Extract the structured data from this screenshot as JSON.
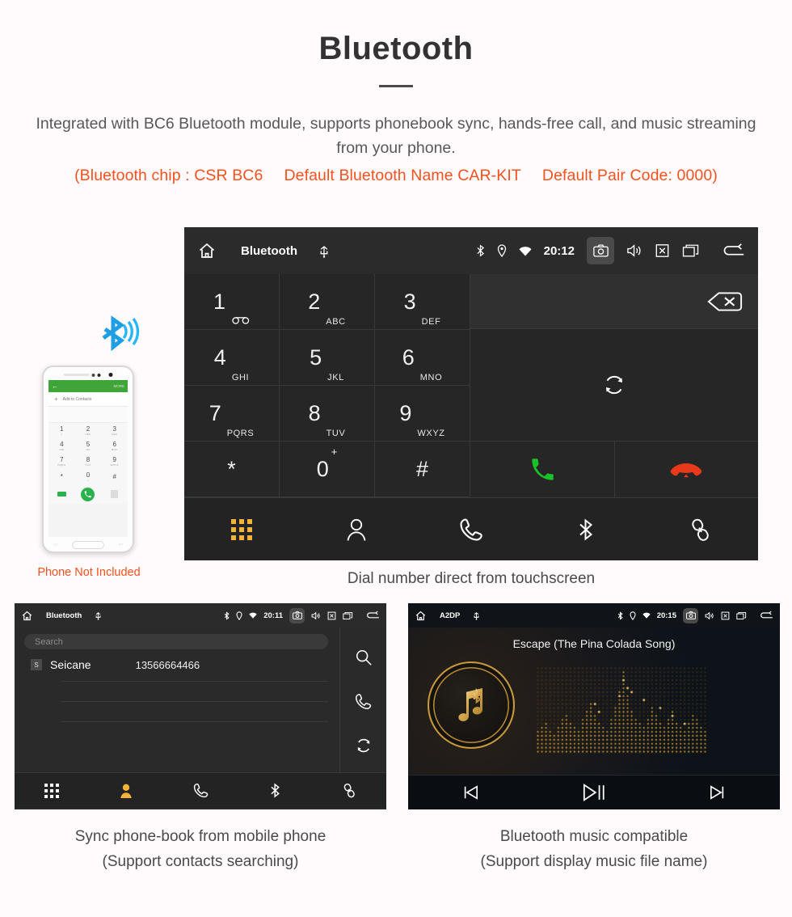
{
  "header": {
    "title": "Bluetooth",
    "description": "Integrated with BC6 Bluetooth module, supports phonebook sync, hands-free call, and music streaming from your phone.",
    "spec_open": "(Bluetooth chip : CSR BC6",
    "spec_name": "Default Bluetooth Name CAR-KIT",
    "spec_pair": "Default Pair Code: 0000)",
    "accent_color": "#f4511e",
    "title_color": "#333333"
  },
  "dialer": {
    "statusbar": {
      "home_icon": "home-icon",
      "title": "Bluetooth",
      "usb_icon": "usb-icon",
      "bluetooth_icon": "bluetooth-icon",
      "location_icon": "location-icon",
      "wifi_icon": "wifi-icon",
      "time": "20:12",
      "camera_icon": "camera-icon",
      "volume_icon": "volume-icon",
      "mute_icon": "mute-box-icon",
      "recents_icon": "recents-icon",
      "back_icon": "back-icon"
    },
    "keys": [
      {
        "num": "1",
        "sub": "",
        "voicemail": true
      },
      {
        "num": "2",
        "sub": "ABC"
      },
      {
        "num": "3",
        "sub": "DEF"
      },
      {
        "num": "4",
        "sub": "GHI"
      },
      {
        "num": "5",
        "sub": "JKL"
      },
      {
        "num": "6",
        "sub": "MNO"
      },
      {
        "num": "7",
        "sub": "PQRS"
      },
      {
        "num": "8",
        "sub": "TUV"
      },
      {
        "num": "9",
        "sub": "WXYZ"
      },
      {
        "num": "*",
        "sub": ""
      },
      {
        "num": "0",
        "sup": "+"
      },
      {
        "num": "#",
        "sub": ""
      }
    ],
    "number_display": "",
    "backspace_icon": "backspace-icon",
    "sync_icon": "sync-icon",
    "call_icon": "call-icon",
    "hangup_icon": "hangup-icon",
    "call_color": "#18c227",
    "hangup_color": "#e8391a",
    "tabs": [
      {
        "name": "dialpad",
        "icon": "dialpad-icon",
        "active": true
      },
      {
        "name": "contacts",
        "icon": "person-icon",
        "active": false
      },
      {
        "name": "call-log",
        "icon": "handset-icon",
        "active": false
      },
      {
        "name": "bluetooth",
        "icon": "bluetooth-icon",
        "active": false
      },
      {
        "name": "pair",
        "icon": "link-icon",
        "active": false
      }
    ],
    "active_tab_color": "#f3b23c",
    "caption": "Dial number direct from touchscreen"
  },
  "phone_mockup": {
    "app_back_icon": "arrow-back-icon",
    "app_more_label": "MORE",
    "add_contacts_label": "Add to Contacts",
    "keys": [
      {
        "num": "1",
        "sub": "∞"
      },
      {
        "num": "2",
        "sub": "ABC"
      },
      {
        "num": "3",
        "sub": "DEF"
      },
      {
        "num": "4",
        "sub": "GHI"
      },
      {
        "num": "5",
        "sub": "JKL"
      },
      {
        "num": "6",
        "sub": "MNO"
      },
      {
        "num": "7",
        "sub": "PQRS"
      },
      {
        "num": "8",
        "sub": "TUV"
      },
      {
        "num": "9",
        "sub": "WXYZ"
      },
      {
        "num": "*",
        "sub": ""
      },
      {
        "num": "0",
        "sub": "+"
      },
      {
        "num": "#",
        "sub": ""
      }
    ],
    "not_included_label": "Phone Not Included",
    "bluetooth_signal_icon": "bluetooth-signal-icon",
    "signal_color": "#1e9fe3"
  },
  "contacts": {
    "statusbar": {
      "home_icon": "home-icon",
      "title": "Bluetooth",
      "usb_icon": "usb-icon",
      "time": "20:11"
    },
    "search_placeholder": "Search",
    "rows": [
      {
        "badge": "S",
        "name": "Seicane",
        "number": "13566664466"
      }
    ],
    "side_actions": [
      {
        "name": "search",
        "icon": "search-icon"
      },
      {
        "name": "call",
        "icon": "handset-icon"
      },
      {
        "name": "sync",
        "icon": "sync-icon"
      }
    ],
    "tabs": [
      {
        "name": "dialpad",
        "icon": "dialpad-icon",
        "active": false
      },
      {
        "name": "contacts",
        "icon": "person-icon",
        "active": true
      },
      {
        "name": "call-log",
        "icon": "handset-icon",
        "active": false
      },
      {
        "name": "bluetooth",
        "icon": "bluetooth-icon",
        "active": false
      },
      {
        "name": "pair",
        "icon": "link-icon",
        "active": false
      }
    ],
    "caption_line1": "Sync phone-book from mobile phone",
    "caption_line2": "(Support contacts searching)"
  },
  "music": {
    "statusbar": {
      "home_icon": "home-icon",
      "title": "A2DP",
      "usb_icon": "usb-icon",
      "time": "20:15"
    },
    "song_title": "Escape (The Pina Colada Song)",
    "album_icon": "music-note-bluetooth-icon",
    "accent_color": "#c99a3e",
    "controls": [
      {
        "name": "previous",
        "icon": "previous-track-icon"
      },
      {
        "name": "play-pause",
        "icon": "play-pause-icon"
      },
      {
        "name": "next",
        "icon": "next-track-icon"
      }
    ],
    "caption_line1": "Bluetooth music compatible",
    "caption_line2": "(Support display music file name)"
  }
}
